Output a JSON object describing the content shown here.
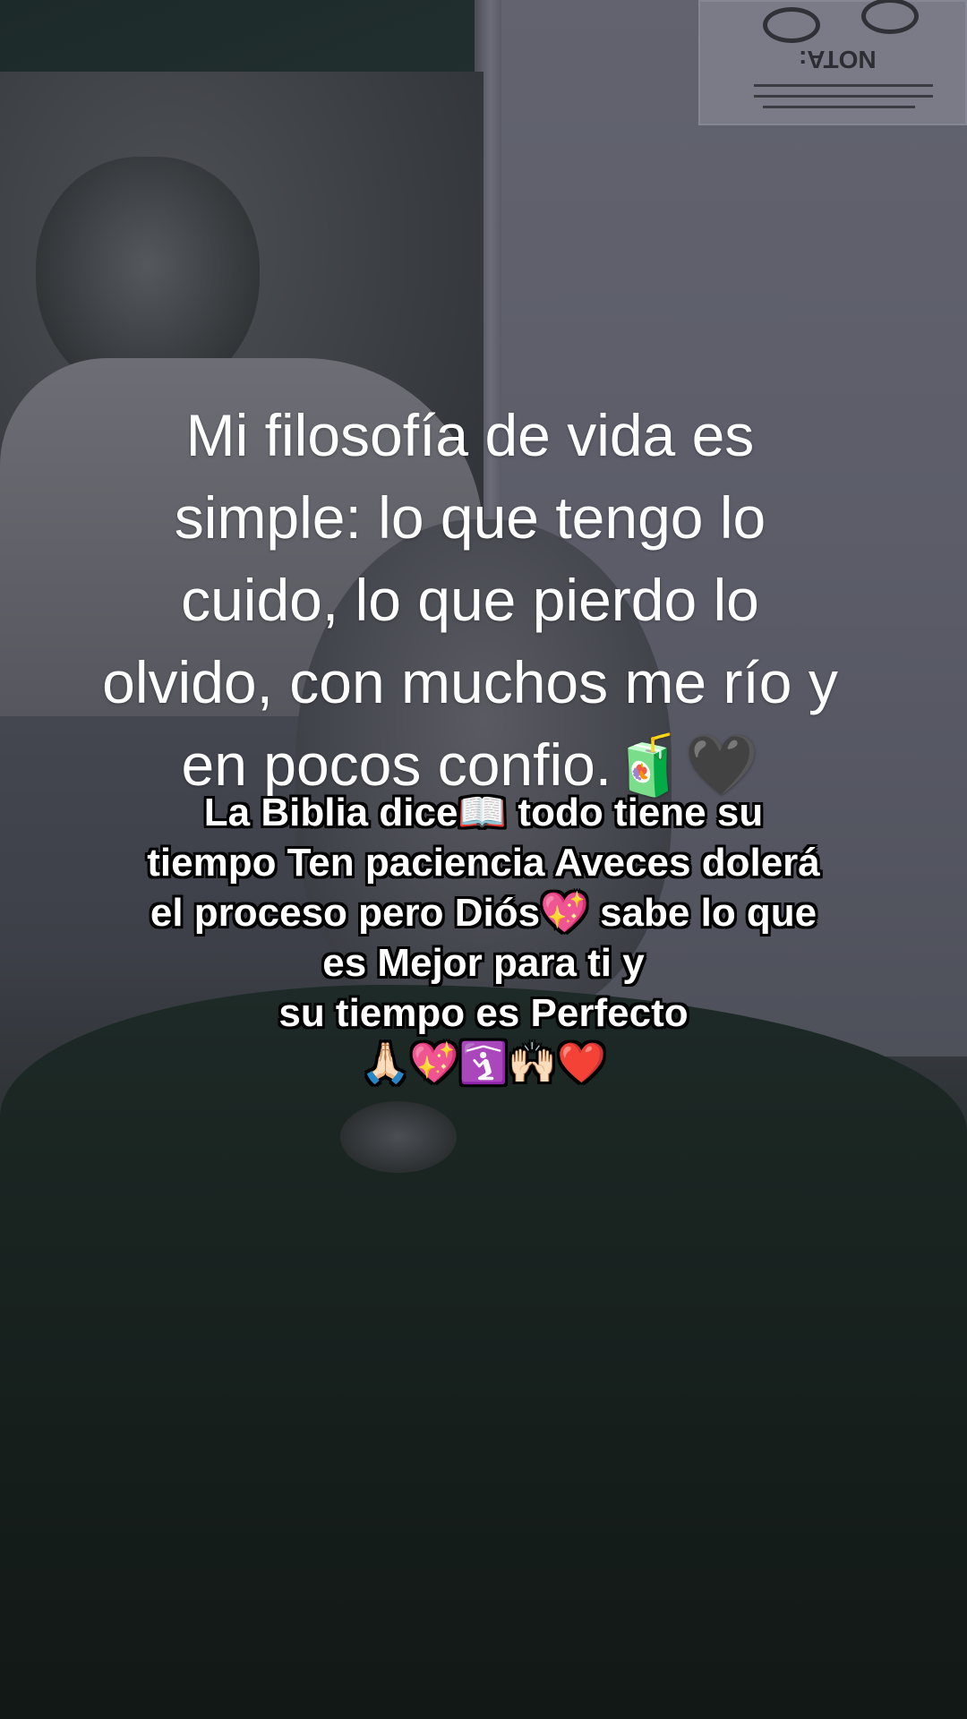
{
  "background": {
    "sign_label": "NOTA:"
  },
  "overlay": {
    "main_caption": "Mi filosofía de vida es\nsimple: lo que tengo lo\ncuido, lo que pierdo lo\nolvido, con muchos me río y\nen pocos confio.🧃🖤",
    "sub_caption": "La Biblia dice📖 todo tiene su\ntiempo Ten paciencia Aveces dolerá\nel proceso pero Diós💖 sabe  lo que\nes Mejor  para ti y\nsu tiempo es Perfecto\n🙏🏻💖🛐🙌🏻❤️"
  }
}
